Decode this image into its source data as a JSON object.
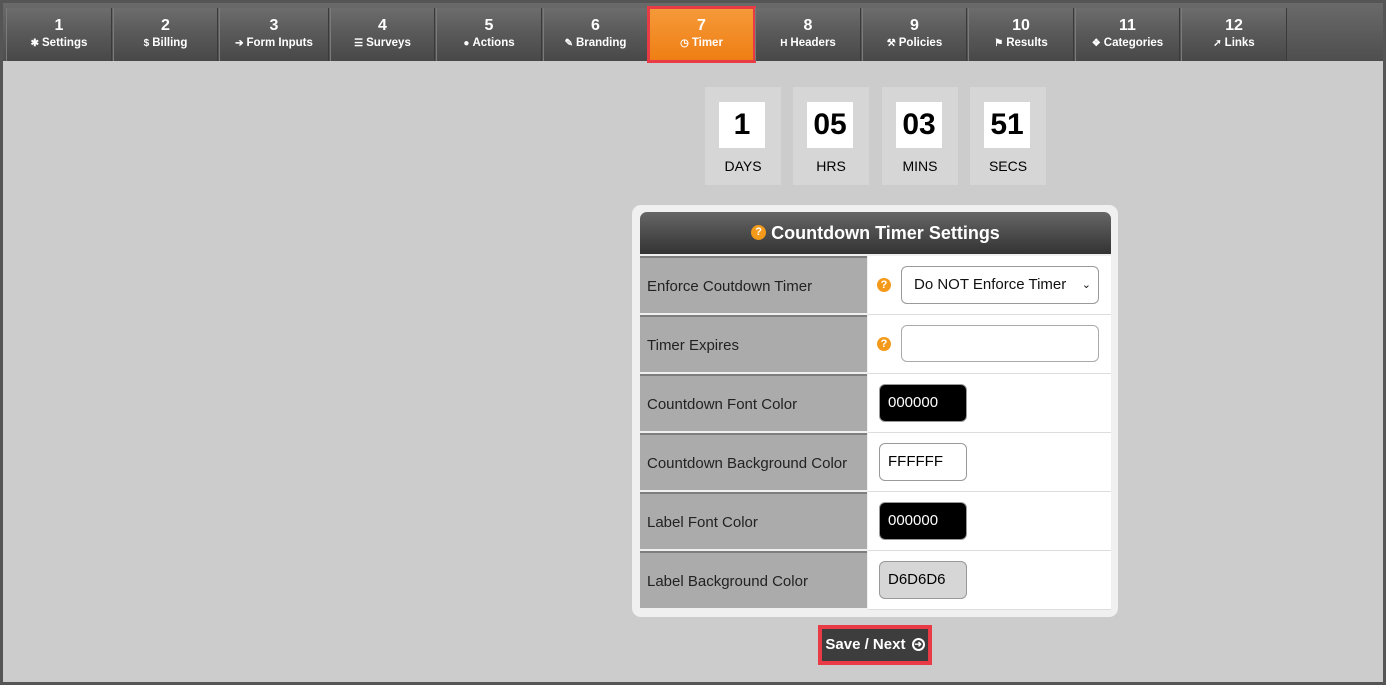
{
  "tabs": [
    {
      "num": "1",
      "label": "Settings",
      "icon": "gear-icon",
      "glyph": "✱"
    },
    {
      "num": "2",
      "label": "Billing",
      "icon": "dollar-icon",
      "glyph": "$"
    },
    {
      "num": "3",
      "label": "Form Inputs",
      "icon": "sign-in-icon",
      "glyph": "➔"
    },
    {
      "num": "4",
      "label": "Surveys",
      "icon": "list-icon",
      "glyph": "☰"
    },
    {
      "num": "5",
      "label": "Actions",
      "icon": "user-icon",
      "glyph": "●"
    },
    {
      "num": "6",
      "label": "Branding",
      "icon": "paintbrush-icon",
      "glyph": "✎"
    },
    {
      "num": "7",
      "label": "Timer",
      "icon": "clock-icon",
      "glyph": "◷"
    },
    {
      "num": "8",
      "label": "Headers",
      "icon": "heading-icon",
      "glyph": "H"
    },
    {
      "num": "9",
      "label": "Policies",
      "icon": "gavel-icon",
      "glyph": "⚒"
    },
    {
      "num": "10",
      "label": "Results",
      "icon": "flag-icon",
      "glyph": "⚑"
    },
    {
      "num": "11",
      "label": "Categories",
      "icon": "cubes-icon",
      "glyph": "❖"
    },
    {
      "num": "12",
      "label": "Links",
      "icon": "pointer-icon",
      "glyph": "➚"
    }
  ],
  "active_tab": "7",
  "countdown": [
    {
      "value": "1",
      "label": "DAYS"
    },
    {
      "value": "05",
      "label": "HRS"
    },
    {
      "value": "03",
      "label": "MINS"
    },
    {
      "value": "51",
      "label": "SECS"
    }
  ],
  "panel": {
    "title": "Countdown Timer Settings",
    "rows": [
      {
        "label": "Enforce Coutdown Timer",
        "type": "select",
        "value": "Do NOT Enforce Timer",
        "help": true
      },
      {
        "label": "Timer Expires",
        "type": "input",
        "value": "",
        "help": true
      },
      {
        "label": "Countdown Font Color",
        "type": "color",
        "value": "000000",
        "bg": "#000000",
        "fg": "#ffffff"
      },
      {
        "label": "Countdown Background Color",
        "type": "color",
        "value": "FFFFFF",
        "bg": "#ffffff",
        "fg": "#000000"
      },
      {
        "label": "Label Font Color",
        "type": "color",
        "value": "000000",
        "bg": "#000000",
        "fg": "#ffffff"
      },
      {
        "label": "Label Background Color",
        "type": "color",
        "value": "D6D6D6",
        "bg": "#d6d6d6",
        "fg": "#000000"
      }
    ]
  },
  "save_label": "Save / Next",
  "colors": {
    "accent": "#ef7e13",
    "highlight": "#e83b45",
    "help": "#f39a1a"
  }
}
